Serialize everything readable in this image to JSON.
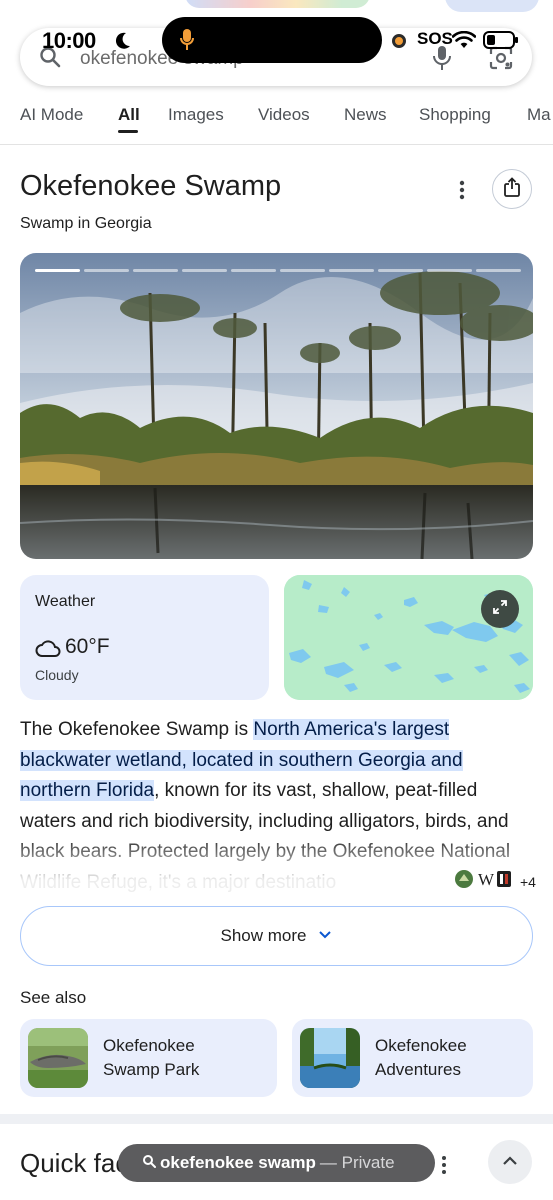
{
  "status_bar": {
    "time": "10:00",
    "sos": "SOS"
  },
  "search": {
    "query": "okefenokee swamp"
  },
  "tabs": [
    {
      "label": "AI Mode"
    },
    {
      "label": "All",
      "active": true
    },
    {
      "label": "Images"
    },
    {
      "label": "Videos"
    },
    {
      "label": "News"
    },
    {
      "label": "Shopping"
    },
    {
      "label": "Ma"
    }
  ],
  "knowledge_panel": {
    "title": "Okefenokee Swamp",
    "subtitle": "Swamp in Georgia",
    "image_count": 10,
    "active_image": 1
  },
  "weather": {
    "label": "Weather",
    "temperature": "60°F",
    "condition": "Cloudy",
    "icon": "cloud-icon"
  },
  "overview": {
    "before": "The Okefenokee Swamp is ",
    "highlight": "North America's largest blackwater wetland, located in southern Georgia and northern Florida",
    "after": ", known for its vast, shallow, peat-filled waters and rich biodiversity, including alligators, birds, and black bears. Protected largely by the Okefenokee National Wildlife Refuge, it's a major destinatio",
    "sources_extra": "+4"
  },
  "show_more": {
    "label": "Show more"
  },
  "see_also": {
    "heading": "See also",
    "items": [
      {
        "line1": "Okefenokee",
        "line2": "Swamp Park"
      },
      {
        "line1": "Okefenokee",
        "line2": "Adventures"
      }
    ]
  },
  "quick_facts": {
    "heading": "Quick facts"
  },
  "bottom_bar": {
    "query": "okefenokee swamp",
    "private": "— Private"
  },
  "colors": {
    "accent": "#d3e3fd",
    "card_bg": "#e9eefc",
    "map_land": "#b7ecc9",
    "map_water": "#7fc9ee"
  }
}
